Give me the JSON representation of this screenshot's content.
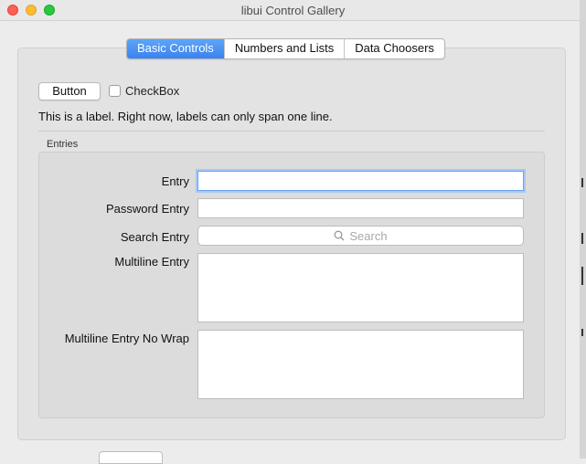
{
  "window": {
    "title": "libui Control Gallery"
  },
  "tabs": [
    {
      "label": "Basic Controls",
      "active": true
    },
    {
      "label": "Numbers and Lists",
      "active": false
    },
    {
      "label": "Data Choosers",
      "active": false
    }
  ],
  "basic": {
    "button_label": "Button",
    "checkbox_label": "CheckBox",
    "checkbox_checked": false,
    "label_text": "This is a label. Right now, labels can only span one line."
  },
  "entries": {
    "group_title": "Entries",
    "entry_label": "Entry",
    "entry_value": "",
    "password_label": "Password Entry",
    "password_value": "",
    "search_label": "Search Entry",
    "search_placeholder": "Search",
    "multiline_label": "Multiline Entry",
    "multiline_value": "",
    "multiline_nowrap_label": "Multiline Entry No Wrap",
    "multiline_nowrap_value": ""
  },
  "icons": {
    "search": "search-icon"
  },
  "colors": {
    "accent": "#3a82f0",
    "focus_ring": "#a6c8f5"
  }
}
